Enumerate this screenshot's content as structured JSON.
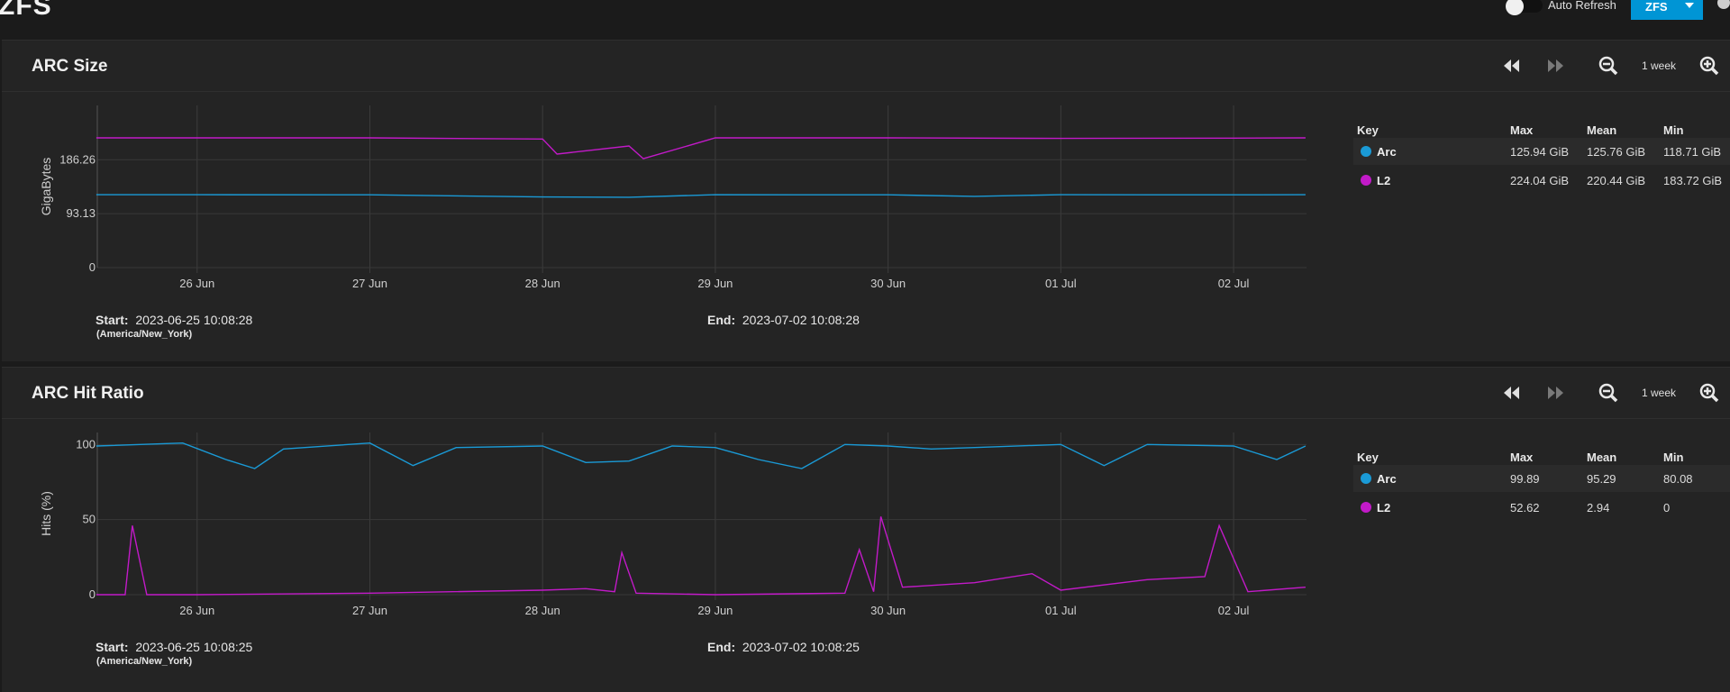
{
  "page": {
    "title": "ZFS"
  },
  "header": {
    "auto_refresh_label": "Auto Refresh",
    "auto_refresh_on": false,
    "zfs_button_label": "ZFS"
  },
  "colors": {
    "arc": "#1a9ad6",
    "l2": "#c21ac8",
    "accent": "#0095d5"
  },
  "panels": [
    {
      "title": "ARC Size",
      "range_label": "1 week",
      "y_axis_label": "GigaBytes",
      "y_ticks": [
        "186.26",
        "93.13",
        "0"
      ],
      "x_ticks": [
        "26 Jun",
        "27 Jun",
        "28 Jun",
        "29 Jun",
        "30 Jun",
        "01 Jul",
        "02 Jul"
      ],
      "start_label": "Start:",
      "start_value": "2023-06-25 10:08:28",
      "timezone": "(America/New_York)",
      "end_label": "End:",
      "end_value": "2023-07-02 10:08:28",
      "key": {
        "headers": {
          "key": "Key",
          "max": "Max",
          "mean": "Mean",
          "min": "Min"
        },
        "rows": [
          {
            "name": "Arc",
            "max": "125.94 GiB",
            "mean": "125.76 GiB",
            "min": "118.71 GiB"
          },
          {
            "name": "L2",
            "max": "224.04 GiB",
            "mean": "220.44 GiB",
            "min": "183.72 GiB"
          }
        ]
      }
    },
    {
      "title": "ARC Hit Ratio",
      "range_label": "1 week",
      "y_axis_label": "Hits (%)",
      "y_ticks": [
        "100",
        "50",
        "0"
      ],
      "x_ticks": [
        "26 Jun",
        "27 Jun",
        "28 Jun",
        "29 Jun",
        "30 Jun",
        "01 Jul",
        "02 Jul"
      ],
      "start_label": "Start:",
      "start_value": "2023-06-25 10:08:25",
      "timezone": "(America/New_York)",
      "end_label": "End:",
      "end_value": "2023-07-02 10:08:25",
      "key": {
        "headers": {
          "key": "Key",
          "max": "Max",
          "mean": "Mean",
          "min": "Min"
        },
        "rows": [
          {
            "name": "Arc",
            "max": "99.89",
            "mean": "95.29",
            "min": "80.08"
          },
          {
            "name": "L2",
            "max": "52.62",
            "mean": "2.94",
            "min": "0"
          }
        ]
      }
    }
  ],
  "chart_data": [
    {
      "type": "line",
      "title": "ARC Size",
      "xlabel": "",
      "ylabel": "GigaBytes",
      "x_range": [
        "2023-06-25 10:08",
        "2023-07-02 10:08"
      ],
      "ylim": [
        0,
        280
      ],
      "grid": true,
      "series": [
        {
          "name": "Arc",
          "color": "#1a9ad6",
          "x": [
            "06-25 10:00",
            "06-26 00:00",
            "06-27 00:00",
            "06-28 00:00",
            "06-28 12:00",
            "06-29 00:00",
            "06-30 00:00",
            "06-30 12:00",
            "07-01 00:00",
            "07-02 00:00",
            "07-02 10:00"
          ],
          "values": [
            125.8,
            125.8,
            125.7,
            122.0,
            121.5,
            125.8,
            125.7,
            123.0,
            125.8,
            125.7,
            125.8
          ]
        },
        {
          "name": "L2",
          "color": "#c21ac8",
          "x": [
            "06-25 10:00",
            "06-26 00:00",
            "06-27 00:00",
            "06-28 00:00",
            "06-28 02:00",
            "06-28 12:00",
            "06-28 14:00",
            "06-29 00:00",
            "06-30 00:00",
            "07-01 00:00",
            "07-02 00:00",
            "07-02 10:00"
          ],
          "values": [
            224.0,
            224.0,
            224.0,
            222.0,
            196.0,
            210.0,
            188.0,
            224.0,
            224.0,
            223.0,
            223.5,
            224.0
          ]
        }
      ]
    },
    {
      "type": "line",
      "title": "ARC Hit Ratio",
      "xlabel": "",
      "ylabel": "Hits (%)",
      "x_range": [
        "2023-06-25 10:08",
        "2023-07-02 10:08"
      ],
      "ylim": [
        0,
        108
      ],
      "grid": true,
      "series": [
        {
          "name": "Arc",
          "color": "#1a9ad6",
          "x": [
            "06-25 10:00",
            "06-25 22:00",
            "06-26 04:00",
            "06-26 08:00",
            "06-26 12:00",
            "06-27 00:00",
            "06-27 06:00",
            "06-27 12:00",
            "06-28 00:00",
            "06-28 06:00",
            "06-28 12:00",
            "06-28 18:00",
            "06-29 00:00",
            "06-29 06:00",
            "06-29 12:00",
            "06-29 18:00",
            "06-30 00:00",
            "06-30 06:00",
            "06-30 12:00",
            "07-01 00:00",
            "07-01 06:00",
            "07-01 12:00",
            "07-02 00:00",
            "07-02 06:00",
            "07-02 10:00"
          ],
          "values": [
            99,
            101,
            90,
            84,
            97,
            101,
            86,
            98,
            99,
            88,
            89,
            99,
            98,
            90,
            84,
            100,
            99,
            97,
            98,
            100,
            86,
            100,
            99,
            90,
            99
          ]
        },
        {
          "name": "L2",
          "color": "#c21ac8",
          "x": [
            "06-25 10:00",
            "06-25 14:00",
            "06-25 15:00",
            "06-25 17:00",
            "06-26 00:00",
            "06-27 00:00",
            "06-28 00:00",
            "06-28 06:00",
            "06-28 10:00",
            "06-28 11:00",
            "06-28 13:00",
            "06-29 00:00",
            "06-29 18:00",
            "06-29 20:00",
            "06-29 22:00",
            "06-29 23:00",
            "06-30 02:00",
            "06-30 12:00",
            "06-30 20:00",
            "07-01 00:00",
            "07-01 12:00",
            "07-01 20:00",
            "07-01 22:00",
            "07-02 02:00",
            "07-02 10:00"
          ],
          "values": [
            0,
            0,
            46,
            0,
            0,
            1,
            3,
            4,
            2,
            28,
            1,
            0,
            1,
            30,
            2,
            52,
            5,
            8,
            14,
            3,
            10,
            12,
            46,
            2,
            5
          ]
        }
      ]
    }
  ]
}
